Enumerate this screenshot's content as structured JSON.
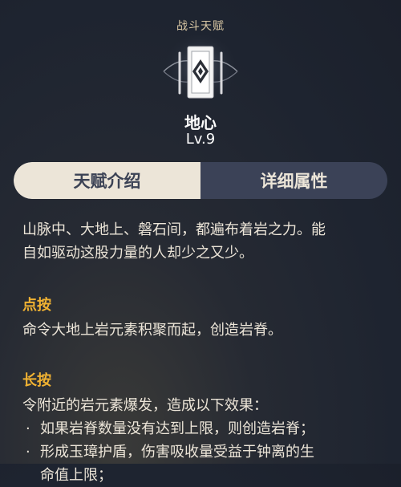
{
  "header": {
    "category": "战斗天赋",
    "name": "地心",
    "level": "Lv.9"
  },
  "tabs": [
    {
      "label": "天赋介绍",
      "active": true
    },
    {
      "label": "详细属性",
      "active": false
    }
  ],
  "description": {
    "line1": "山脉中、大地上、磐石间，都遍布着岩之力。能",
    "line2": "自如驱动这股力量的人却少之又少。"
  },
  "sections": {
    "tap": {
      "title": "点按",
      "text": "命令大地上岩元素积聚而起，创造岩脊。"
    },
    "hold": {
      "title": "长按",
      "text": "令附近的岩元素爆发，造成以下效果：",
      "bullets": [
        "如果岩脊数量没有达到上限，则创造岩脊；",
        "形成玉璋护盾，伤害吸收量受益于钟离的生",
        "命值上限；"
      ]
    }
  },
  "colors": {
    "accent": "#f0b232",
    "tab_active_bg": "#ece5d8",
    "tab_inactive_bg": "#3b4257",
    "background": "#1e2430"
  }
}
